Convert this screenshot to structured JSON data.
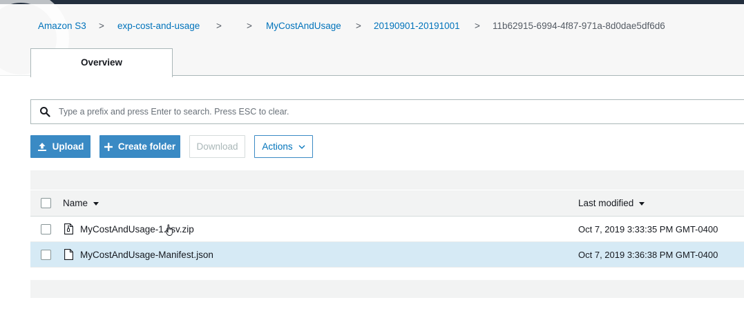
{
  "breadcrumb": {
    "items": [
      "Amazon S3",
      "exp-cost-and-usage",
      "MyCostAndUsage",
      "20190901-20191001"
    ],
    "separator": ">",
    "current": "11b62915-6994-4f87-971a-8d0dae5df6d6"
  },
  "tabs": [
    {
      "label": "Overview",
      "active": true
    }
  ],
  "search": {
    "placeholder": "Type a prefix and press Enter to search. Press ESC to clear.",
    "value": ""
  },
  "toolbar": {
    "upload_label": "Upload",
    "create_folder_label": "Create folder",
    "download_label": "Download",
    "actions_label": "Actions"
  },
  "table": {
    "columns": {
      "name": "Name",
      "last_modified": "Last modified"
    },
    "rows": [
      {
        "name": "MyCostAndUsage-1.csv.zip",
        "last_modified": "Oct 7, 2019 3:33:35 PM GMT-0400",
        "icon": "zip-file-icon",
        "selected": false
      },
      {
        "name": "MyCostAndUsage-Manifest.json",
        "last_modified": "Oct 7, 2019 3:36:38 PM GMT-0400",
        "icon": "file-icon",
        "selected": false
      }
    ]
  },
  "colors": {
    "primary_button": "#3a8ac4",
    "link": "#0073bb",
    "row_highlight": "#d6eaf5",
    "topbar": "#232f3e"
  }
}
